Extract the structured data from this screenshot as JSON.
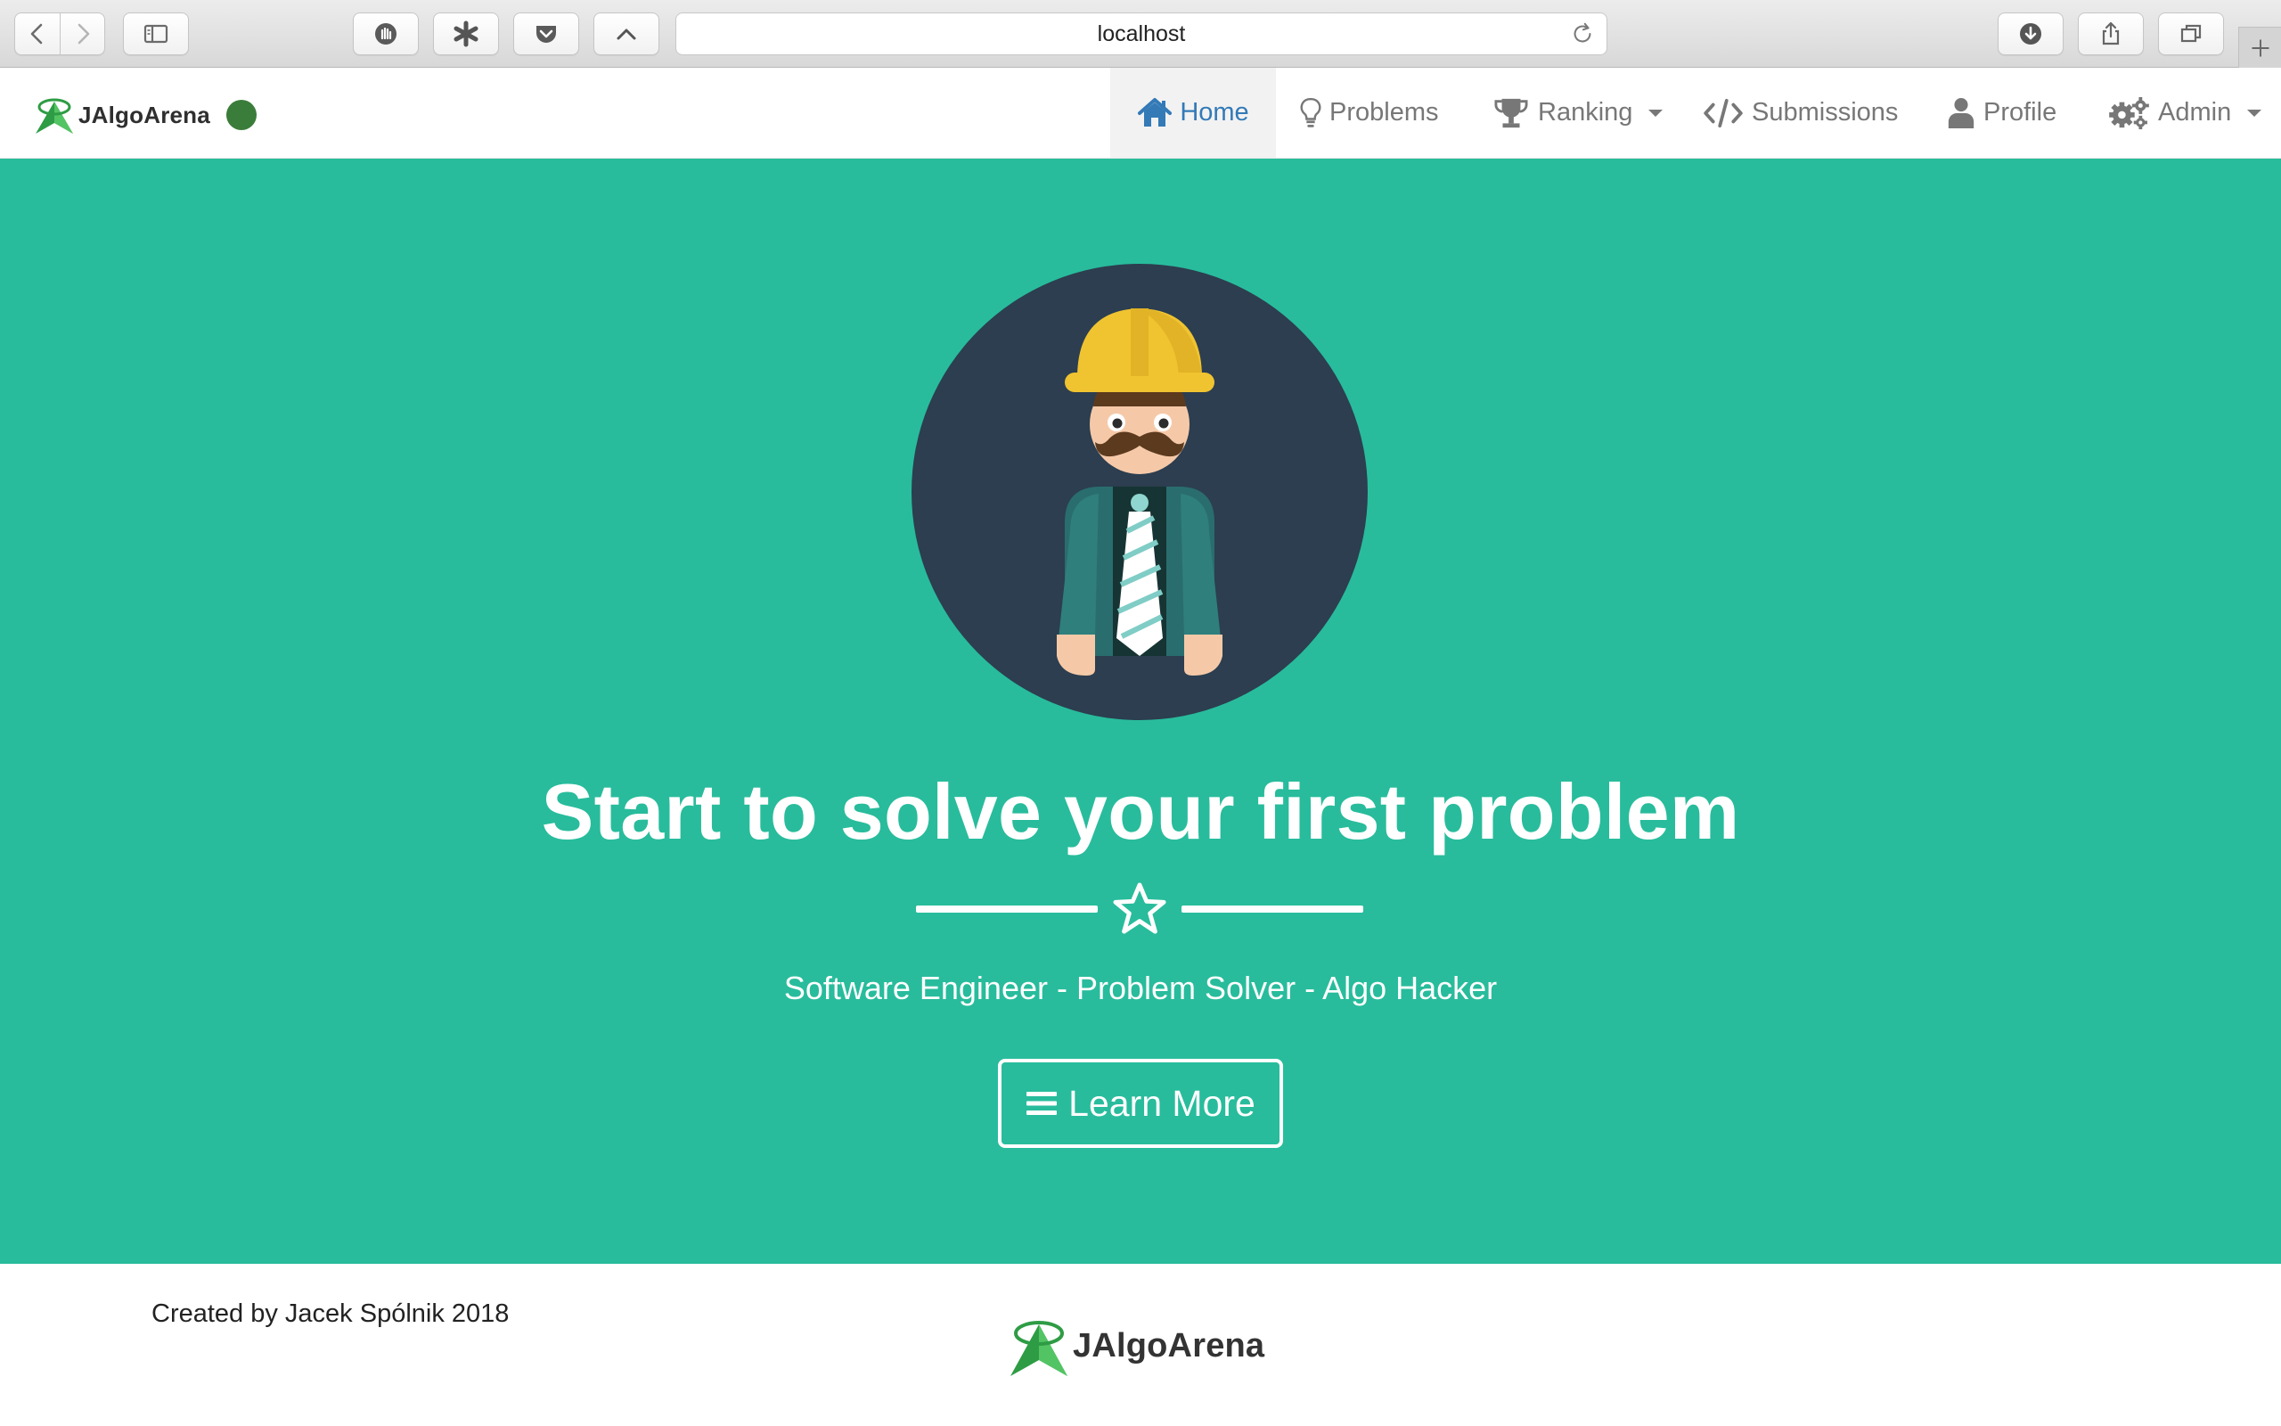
{
  "browser": {
    "url": "localhost",
    "icons": {
      "back": "chevron-left-icon",
      "forward": "chevron-right-icon",
      "sidebar": "sidebar-icon",
      "reload": "reload-icon",
      "download": "download-icon",
      "share": "share-icon",
      "tabs": "tabs-icon",
      "new_tab": "plus-icon"
    }
  },
  "navbar": {
    "brand": "JAlgoArena",
    "status_color": "#3a7d3a",
    "items": [
      {
        "label": "Home",
        "icon": "home-icon",
        "active": true
      },
      {
        "label": "Problems",
        "icon": "lightbulb-icon",
        "active": false
      },
      {
        "label": "Ranking",
        "icon": "trophy-icon",
        "active": false,
        "dropdown": true
      },
      {
        "label": "Submissions",
        "icon": "code-icon",
        "active": false
      },
      {
        "label": "Profile",
        "icon": "user-icon",
        "active": false
      },
      {
        "label": "Admin",
        "icon": "gears-icon",
        "active": false,
        "dropdown": true
      }
    ]
  },
  "hero": {
    "title": "Start to solve your first problem",
    "subtitle": "Software Engineer - Problem Solver - Algo Hacker",
    "button_label": "Learn More",
    "background": "#28bc9c"
  },
  "footer": {
    "credit": "Created by Jacek Spólnik 2018",
    "brand": "JAlgoArena"
  },
  "colors": {
    "accent": "#337ab7",
    "hero": "#28bc9c",
    "avatar_bg": "#2c3e50"
  }
}
